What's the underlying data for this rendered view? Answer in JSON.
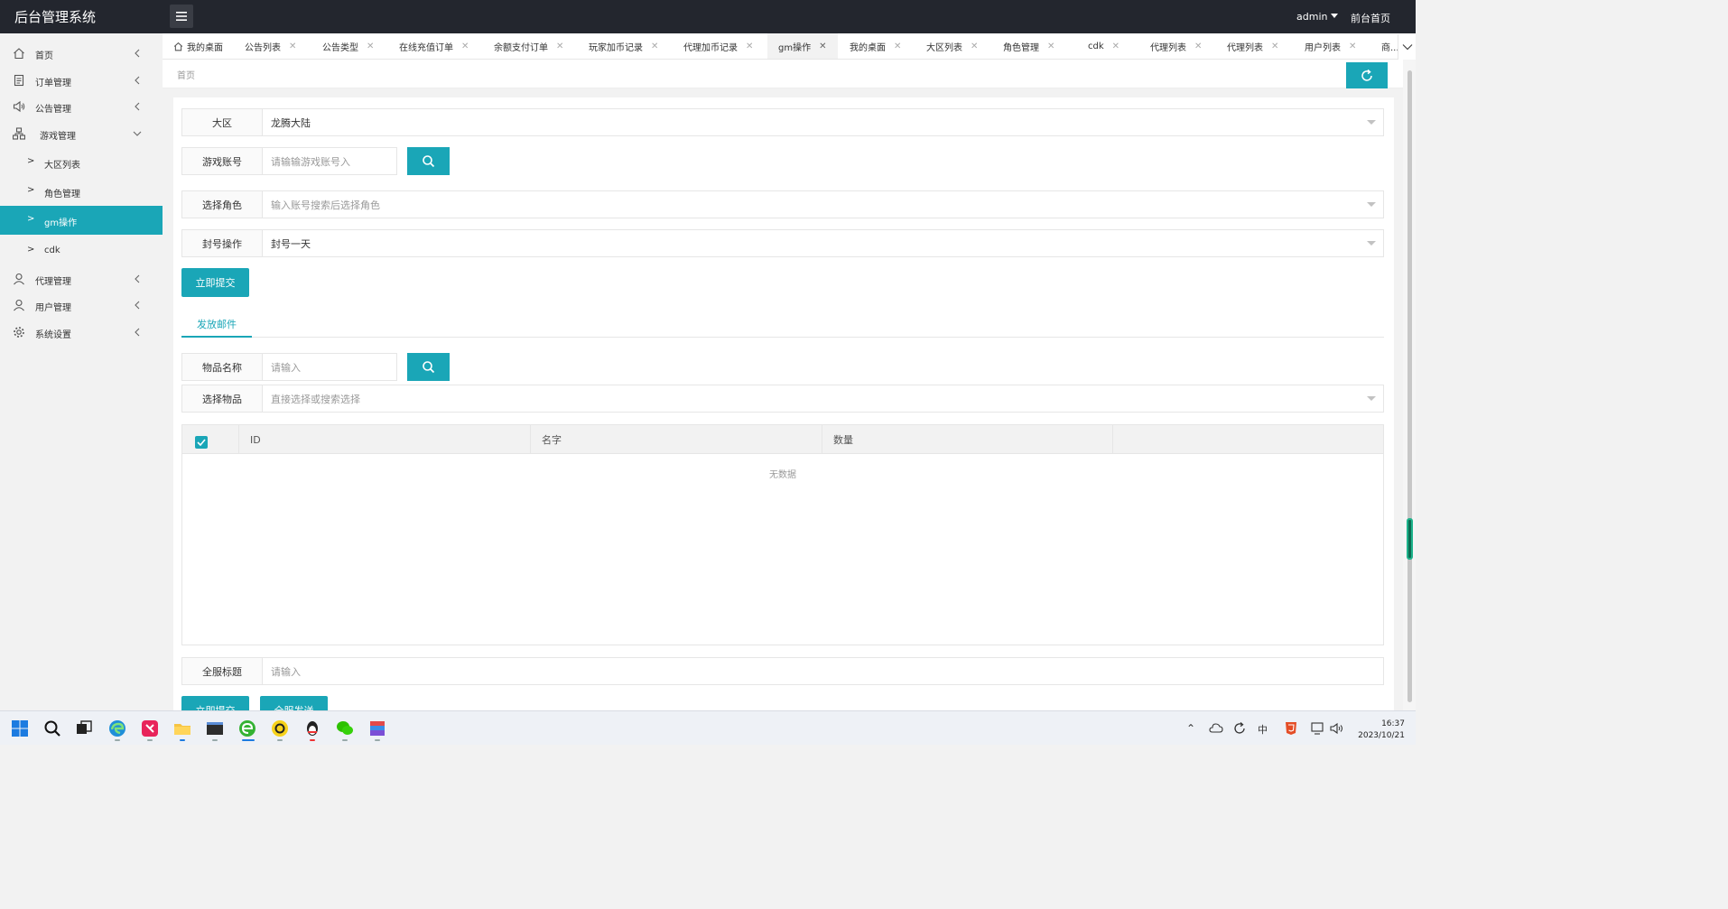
{
  "app": {
    "title": "后台管理系统"
  },
  "header": {
    "user": "admin",
    "front_link": "前台首页"
  },
  "sidebar": {
    "items": [
      {
        "label": "首页",
        "icon": "home-icon"
      },
      {
        "label": "订单管理",
        "icon": "document-icon"
      },
      {
        "label": "公告管理",
        "icon": "speaker-icon"
      },
      {
        "label": "游戏管理",
        "icon": "sitemap-icon"
      },
      {
        "label": "代理管理",
        "icon": "user-icon"
      },
      {
        "label": "用户管理",
        "icon": "user-icon"
      },
      {
        "label": "系统设置",
        "icon": "gear-icon"
      }
    ],
    "sub_items": [
      {
        "label": "大区列表",
        "active": false
      },
      {
        "label": "角色管理",
        "active": false
      },
      {
        "label": "gm操作",
        "active": true
      },
      {
        "label": "cdk",
        "active": false
      }
    ]
  },
  "tabs": [
    {
      "label": "我的桌面",
      "home_icon": true
    },
    {
      "label": "公告列表"
    },
    {
      "label": "公告类型"
    },
    {
      "label": "在线充值订单"
    },
    {
      "label": "余额支付订单"
    },
    {
      "label": "玩家加币记录"
    },
    {
      "label": "代理加币记录"
    },
    {
      "label": "gm操作",
      "active": true
    },
    {
      "label": "我的桌面"
    },
    {
      "label": "大区列表"
    },
    {
      "label": "角色管理"
    },
    {
      "label": "cdk"
    },
    {
      "label": "代理列表"
    },
    {
      "label": "代理列表"
    },
    {
      "label": "用户列表"
    },
    {
      "label": "商..."
    }
  ],
  "breadcrumb": "首页",
  "form": {
    "region": {
      "label": "大区",
      "value": "龙腾大陆"
    },
    "account": {
      "label": "游戏账号",
      "placeholder": "请输输游戏账号入"
    },
    "role": {
      "label": "选择角色",
      "placeholder": "输入账号搜索后选择角色"
    },
    "ban": {
      "label": "封号操作",
      "value": "封号一天"
    },
    "submit": "立即提交"
  },
  "mail_tab": "发放邮件",
  "mail": {
    "item_name": {
      "label": "物品名称",
      "placeholder": "请输入"
    },
    "select_item": {
      "label": "选择物品",
      "placeholder": "直接选择或搜索选择"
    },
    "table": {
      "columns": [
        "ID",
        "名字",
        "数量",
        ""
      ],
      "empty": "无数据"
    },
    "title": {
      "label": "全服标题",
      "placeholder": "请输入"
    },
    "submit": "立即提交",
    "send_all": "全服发送"
  },
  "taskbar": {
    "time": "16:37",
    "date": "2023/10/21"
  },
  "colors": {
    "accent": "#1aa6b7",
    "topbar": "#23262e"
  }
}
